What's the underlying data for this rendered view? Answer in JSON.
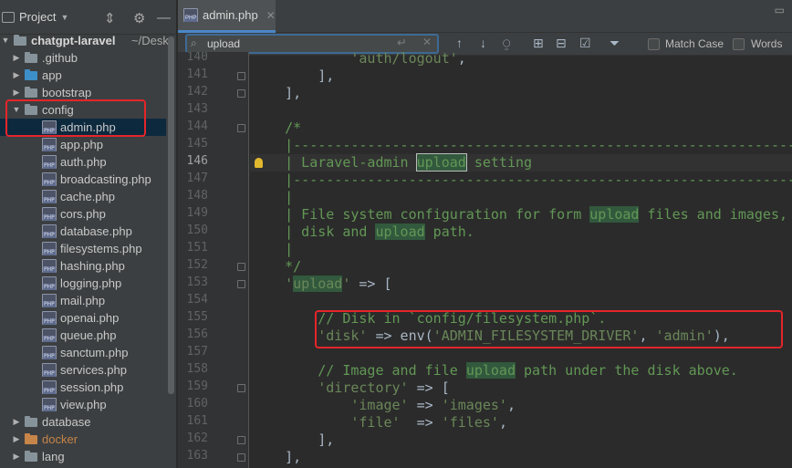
{
  "project_panel": {
    "title": "Project",
    "tree": [
      {
        "label": "chatgpt-laravel",
        "suffix": "~/Desk",
        "kind": "root",
        "open": true
      },
      {
        "label": ".github",
        "kind": "folder"
      },
      {
        "label": "app",
        "kind": "folder-blue"
      },
      {
        "label": "bootstrap",
        "kind": "folder"
      },
      {
        "label": "config",
        "kind": "folder",
        "open": true
      },
      {
        "label": "admin.php",
        "kind": "php",
        "selected": true
      },
      {
        "label": "app.php",
        "kind": "php"
      },
      {
        "label": "auth.php",
        "kind": "php"
      },
      {
        "label": "broadcasting.php",
        "kind": "php"
      },
      {
        "label": "cache.php",
        "kind": "php"
      },
      {
        "label": "cors.php",
        "kind": "php"
      },
      {
        "label": "database.php",
        "kind": "php"
      },
      {
        "label": "filesystems.php",
        "kind": "php"
      },
      {
        "label": "hashing.php",
        "kind": "php"
      },
      {
        "label": "logging.php",
        "kind": "php"
      },
      {
        "label": "mail.php",
        "kind": "php"
      },
      {
        "label": "openai.php",
        "kind": "php"
      },
      {
        "label": "queue.php",
        "kind": "php"
      },
      {
        "label": "sanctum.php",
        "kind": "php"
      },
      {
        "label": "services.php",
        "kind": "php"
      },
      {
        "label": "session.php",
        "kind": "php"
      },
      {
        "label": "view.php",
        "kind": "php"
      },
      {
        "label": "database",
        "kind": "folder"
      },
      {
        "label": "docker",
        "kind": "folder-orange"
      },
      {
        "label": "lang",
        "kind": "folder"
      }
    ]
  },
  "editor": {
    "tab_label": "admin.php",
    "find": {
      "query": "upload",
      "match_case_label": "Match Case",
      "words_label": "Words"
    },
    "current_line": "146",
    "line_numbers": [
      "140",
      "141",
      "142",
      "143",
      "144",
      "145",
      "146",
      "147",
      "148",
      "149",
      "150",
      "151",
      "152",
      "153",
      "154",
      "155",
      "156",
      "157",
      "158",
      "159",
      "160",
      "161",
      "162",
      "163"
    ],
    "code": [
      "            'auth/logout',",
      "        ],",
      "    ],",
      "",
      "    /*",
      "    |--------------------------------------------------------------------------",
      "    | Laravel-admin upload setting",
      "    |--------------------------------------------------------------------------",
      "    |",
      "    | File system configuration for form upload files and images, including",
      "    | disk and upload path.",
      "    |",
      "    */",
      "    'upload' => [",
      "",
      "        // Disk in `config/filesystem.php`.",
      "        'disk' => env('ADMIN_FILESYSTEM_DRIVER', 'admin'),",
      "",
      "        // Image and file upload path under the disk above.",
      "        'directory' => [",
      "            'image' => 'images',",
      "            'file'  => 'files',",
      "        ],",
      "    ],"
    ]
  }
}
